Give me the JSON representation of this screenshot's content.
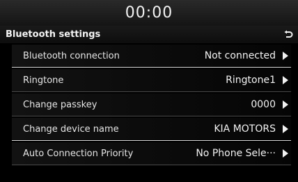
{
  "status": {
    "time": "00:00"
  },
  "header": {
    "title": "Bluetooth settings",
    "back_icon": "back-arrow-icon"
  },
  "settings": [
    {
      "label": "Bluetooth connection",
      "value": "Not connected"
    },
    {
      "label": "Ringtone",
      "value": "Ringtone1"
    },
    {
      "label": "Change passkey",
      "value": "0000"
    },
    {
      "label": "Change device name",
      "value": "KIA MOTORS"
    },
    {
      "label": "Auto Connection Priority",
      "value": "No Phone Sele···"
    }
  ],
  "colors": {
    "background": "#000000",
    "text": "#e6e6e6",
    "divider": "#4a4a4a"
  }
}
